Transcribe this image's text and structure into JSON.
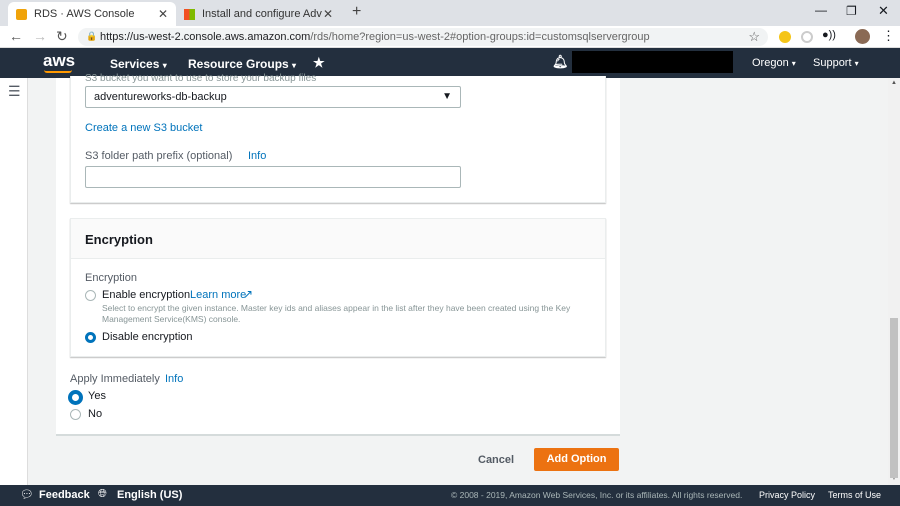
{
  "browser": {
    "tabs": [
      {
        "title": "RDS · AWS Console"
      },
      {
        "title": "Install and configure AdventureW"
      }
    ],
    "url_host": "https://us-west-2.console.aws.amazon.com",
    "url_rest": "/rds/home?region=us-west-2#option-groups:id=customsqlservergroup"
  },
  "nav": {
    "logo": "aws",
    "services": "Services",
    "resource_groups": "Resource Groups",
    "region": "Oregon",
    "support": "Support"
  },
  "s3": {
    "bucket_hint": "S3 bucket you want to use to store your backup files",
    "bucket_value": "adventureworks-db-backup",
    "create_link": "Create a new S3 bucket",
    "prefix_label": "S3 folder path prefix (optional)",
    "prefix_info": "Info",
    "prefix_value": ""
  },
  "encryption": {
    "title": "Encryption",
    "label": "Encryption",
    "enable": "Enable encryption",
    "learn_more": "Learn more",
    "enable_desc": "Select to encrypt the given instance. Master key ids and aliases appear in the list after they have been created using the Key Management Service(KMS) console.",
    "disable": "Disable encryption",
    "selected": "disable"
  },
  "apply": {
    "label": "Apply Immediately",
    "info": "Info",
    "yes": "Yes",
    "no": "No",
    "selected": "yes"
  },
  "actions": {
    "cancel": "Cancel",
    "add": "Add Option"
  },
  "footer": {
    "feedback": "Feedback",
    "language": "English (US)",
    "copyright": "© 2008 - 2019, Amazon Web Services, Inc. or its affiliates. All rights reserved.",
    "privacy": "Privacy Policy",
    "terms": "Terms of Use"
  },
  "colors": {
    "nav": "#232f3e",
    "accent": "#ec7211",
    "link": "#0073bb"
  }
}
